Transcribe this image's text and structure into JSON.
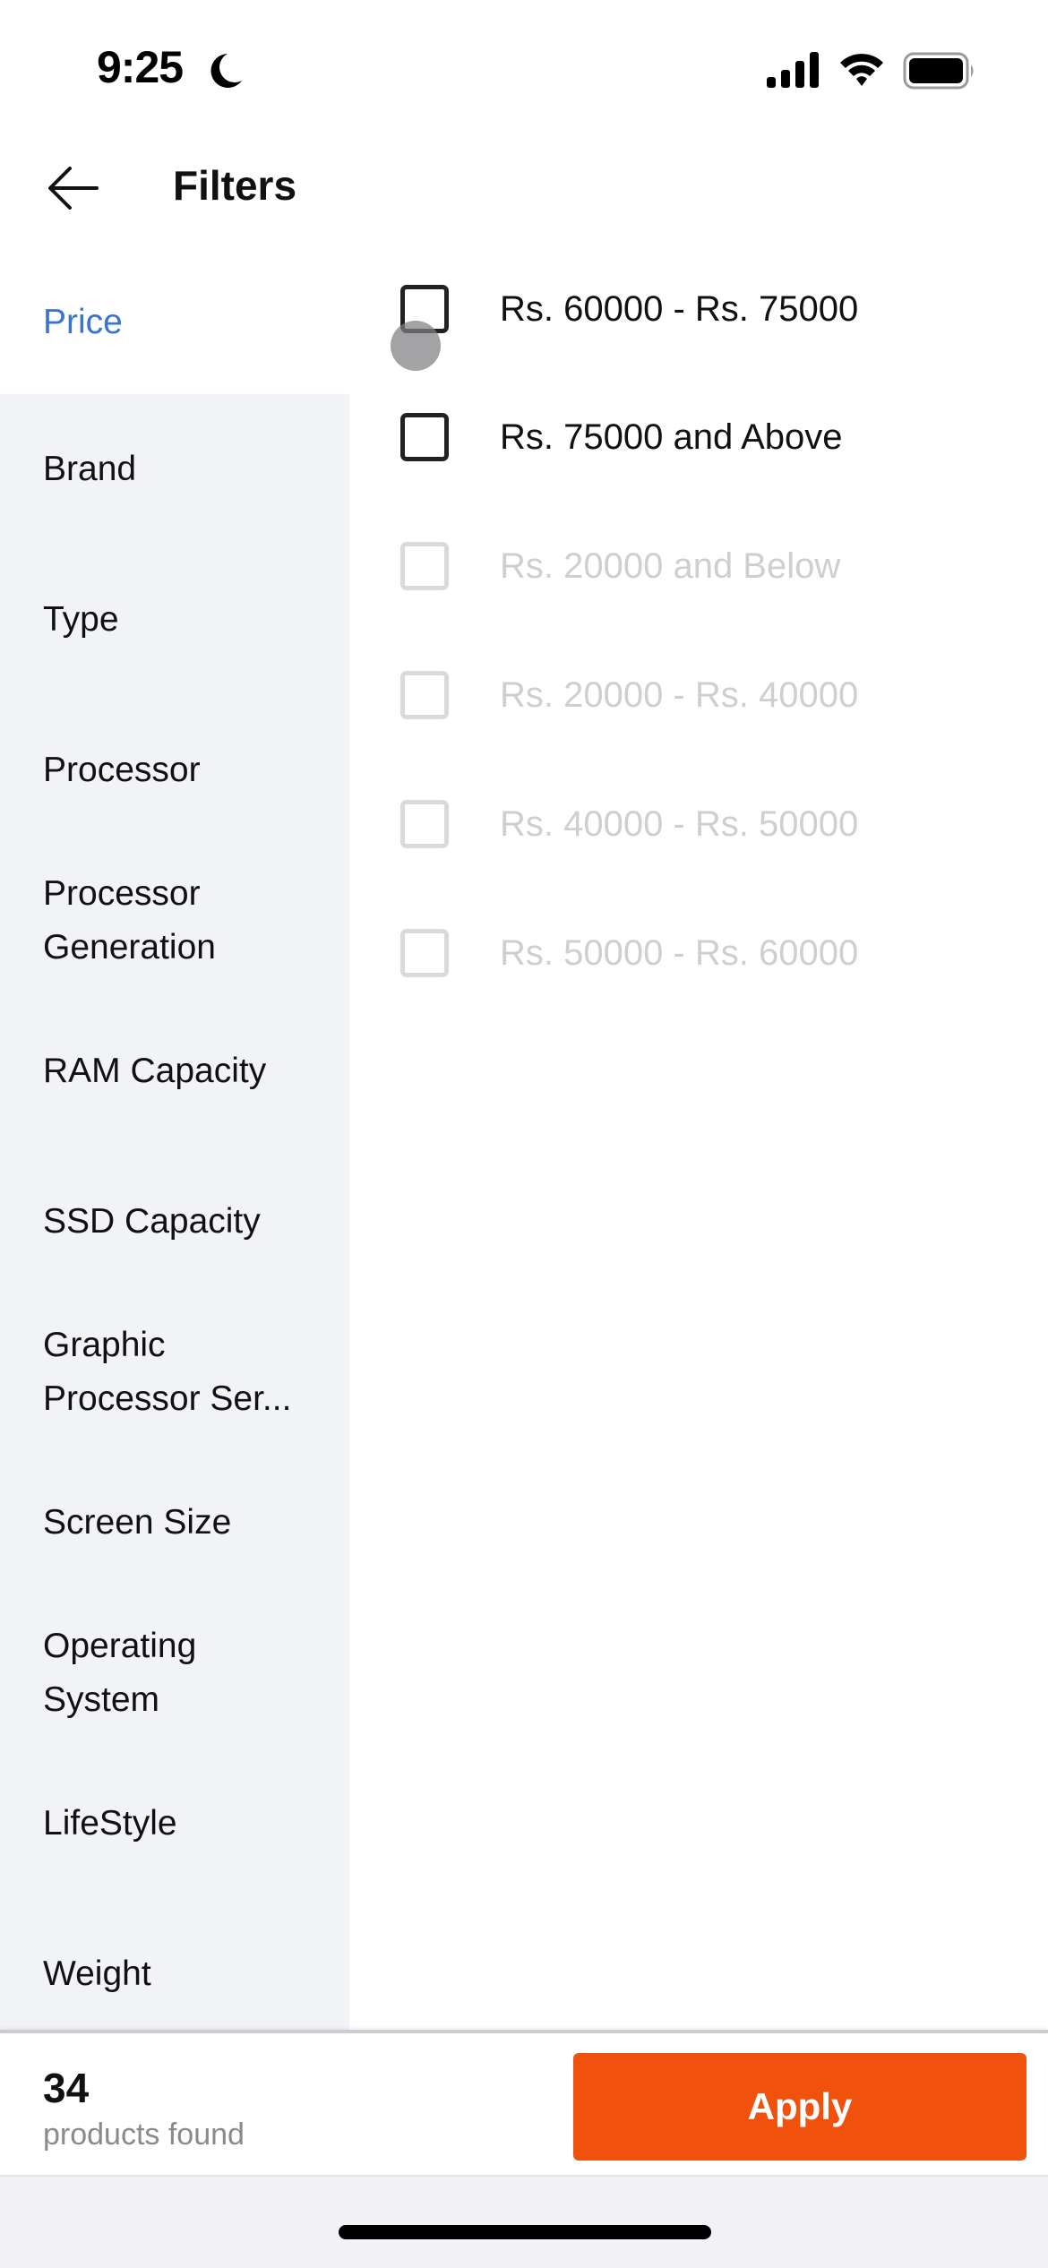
{
  "status_bar": {
    "time": "9:25",
    "icons": [
      "moon-icon",
      "signal-icon",
      "wifi-icon",
      "battery-icon"
    ]
  },
  "header": {
    "back_icon": "arrow-left-icon",
    "title": "Filters"
  },
  "sidebar": {
    "active_index": 0,
    "items": [
      {
        "label": "Price"
      },
      {
        "label": "Brand"
      },
      {
        "label": "Type"
      },
      {
        "label": "Processor"
      },
      {
        "label": "Processor Generation"
      },
      {
        "label": "RAM Capacity"
      },
      {
        "label": "SSD Capacity"
      },
      {
        "label": "Graphic Processor Ser..."
      },
      {
        "label": "Screen Size"
      },
      {
        "label": "Operating System"
      },
      {
        "label": "LifeStyle"
      },
      {
        "label": "Weight"
      }
    ]
  },
  "options": [
    {
      "label": "Rs. 60000 - Rs. 75000",
      "checked": false,
      "enabled": true
    },
    {
      "label": "Rs. 75000 and Above",
      "checked": false,
      "enabled": true
    },
    {
      "label": "Rs. 20000 and Below",
      "checked": false,
      "enabled": false
    },
    {
      "label": "Rs. 20000 - Rs. 40000",
      "checked": false,
      "enabled": false
    },
    {
      "label": "Rs. 40000 - Rs. 50000",
      "checked": false,
      "enabled": false
    },
    {
      "label": "Rs. 50000 - Rs. 60000",
      "checked": false,
      "enabled": false
    }
  ],
  "footer": {
    "count": "34",
    "count_label": "products found",
    "apply_label": "Apply"
  },
  "colors": {
    "accent_active": "#3A74D0",
    "apply_button": "#F0510D",
    "sidebar_bg": "#F2F3F7",
    "disabled_text": "#CFCFD2"
  }
}
